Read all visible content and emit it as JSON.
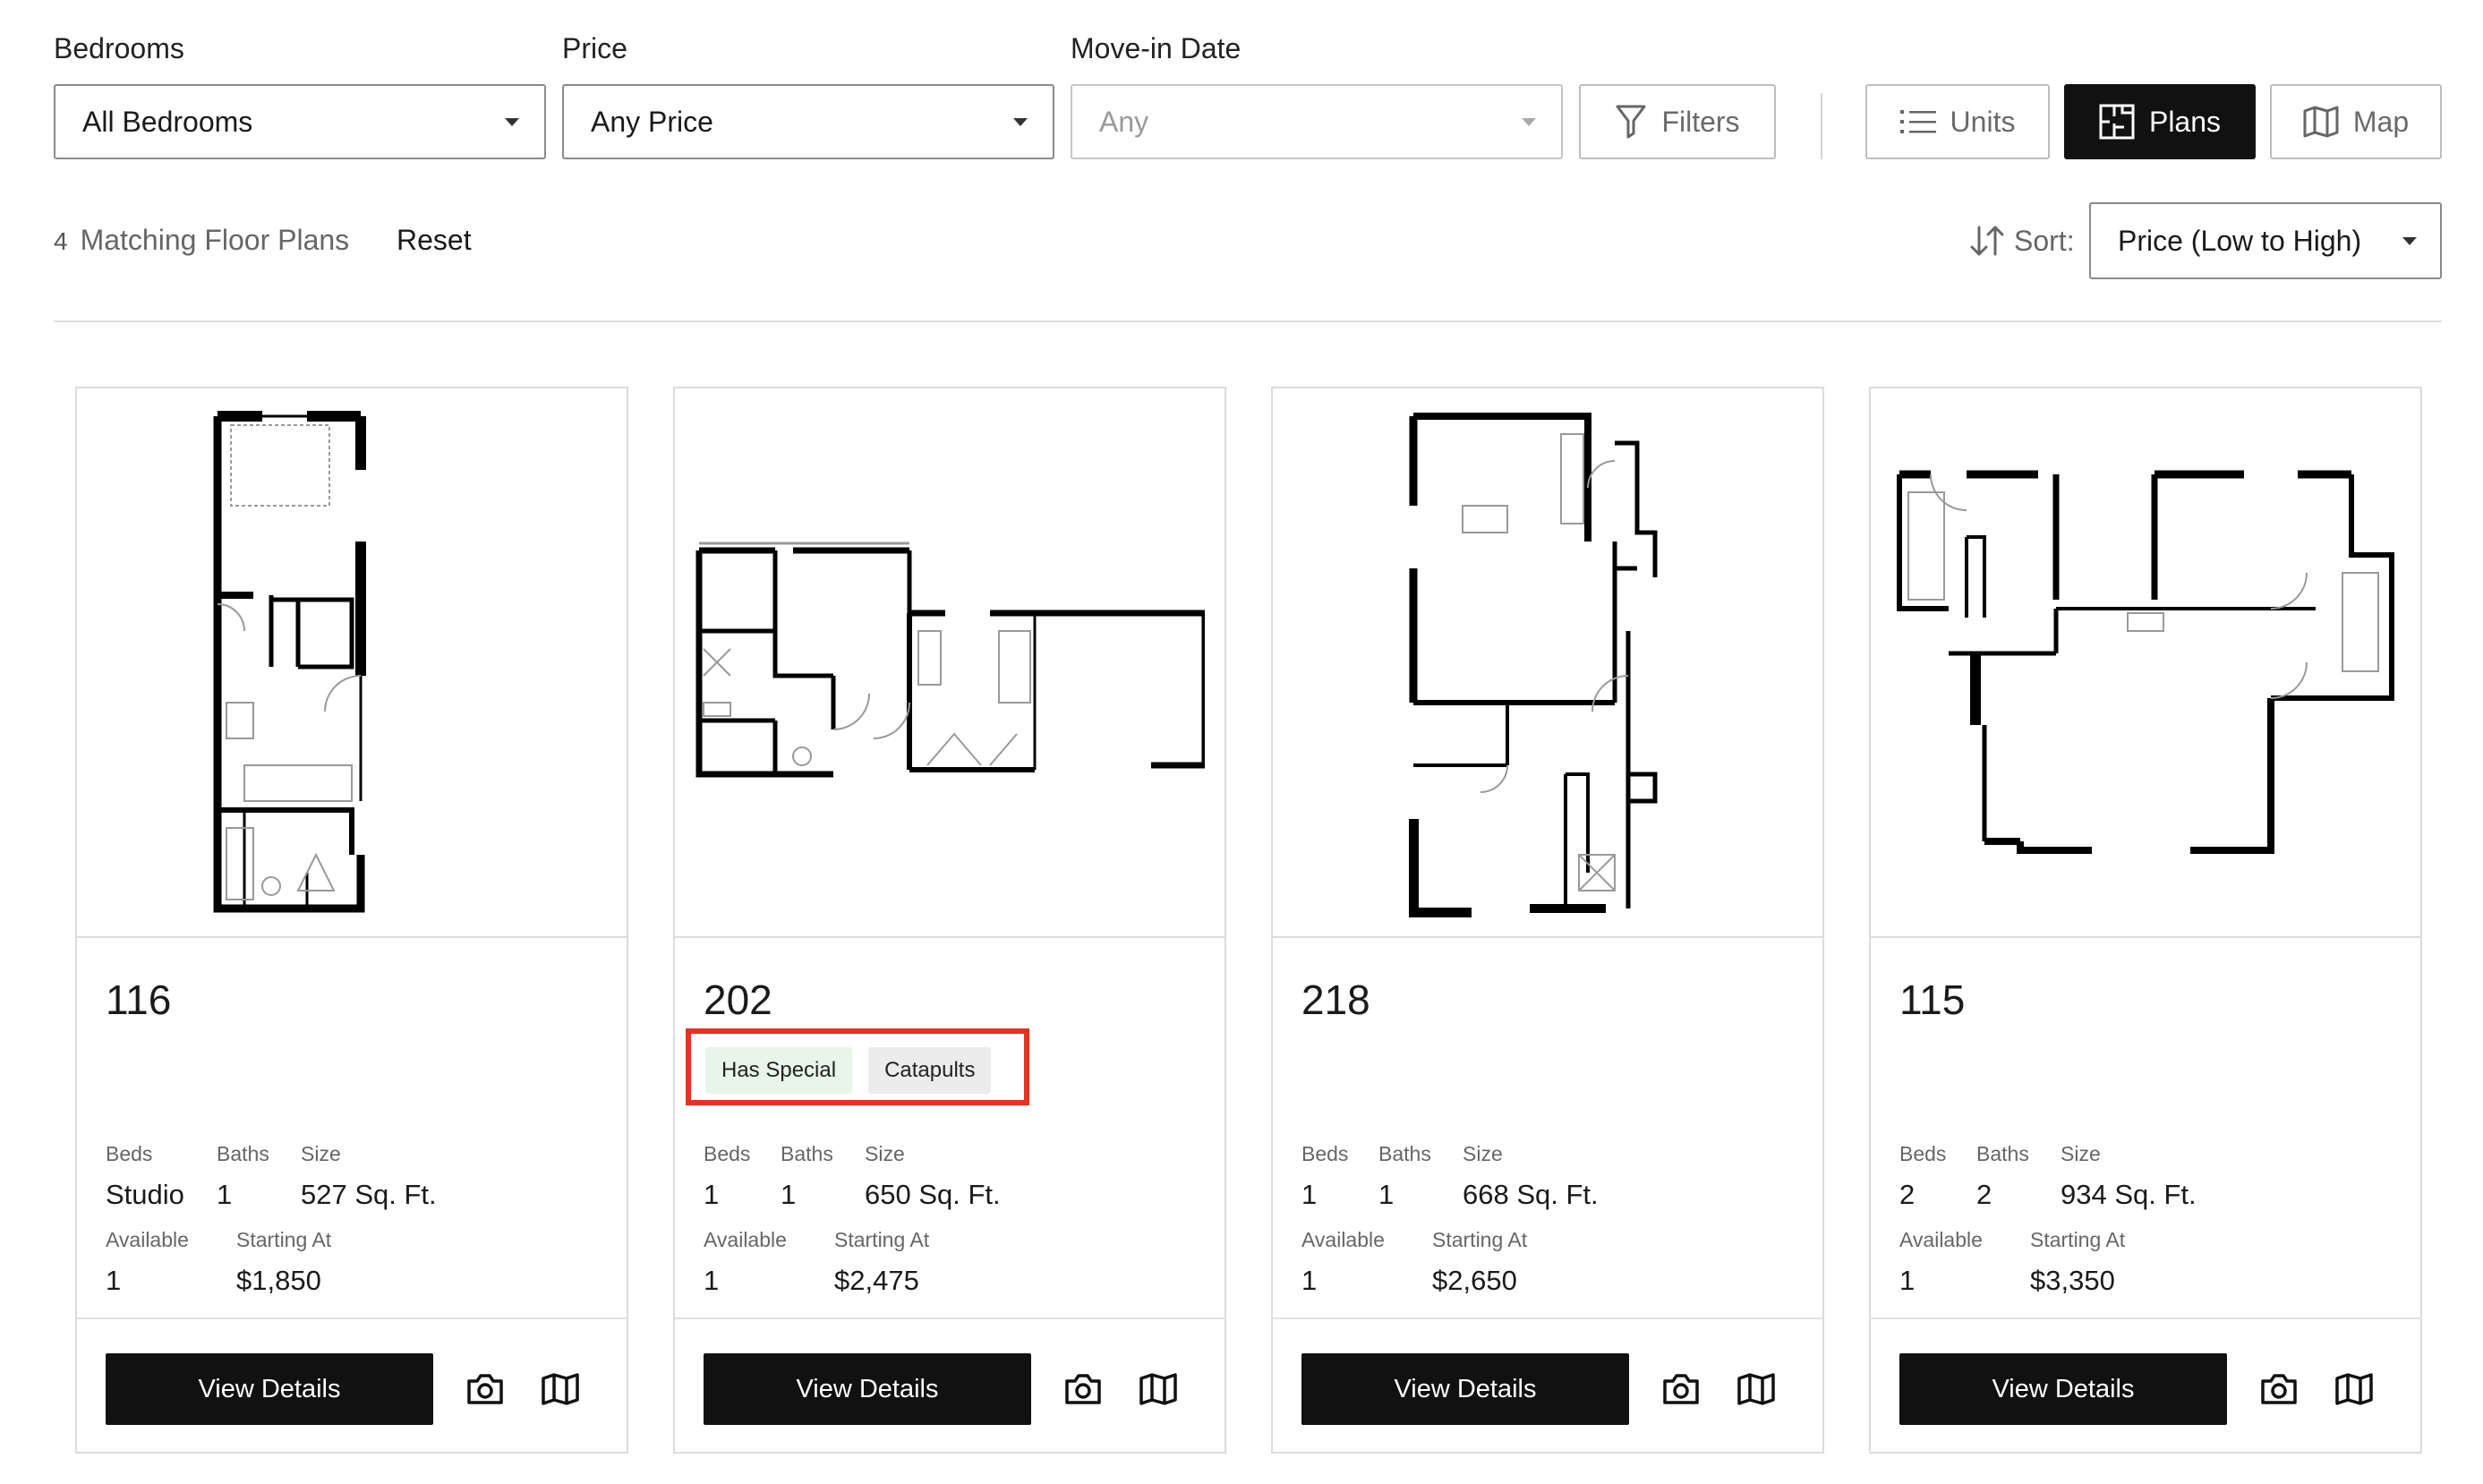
{
  "filters": {
    "bedrooms": {
      "label": "Bedrooms",
      "value": "All Bedrooms"
    },
    "price": {
      "label": "Price",
      "value": "Any Price"
    },
    "move_in": {
      "label": "Move-in Date",
      "value": "Any"
    },
    "filters_button": "Filters"
  },
  "views": {
    "units": "Units",
    "plans": "Plans",
    "map": "Map",
    "active": "Plans"
  },
  "results": {
    "count": "4",
    "label": "Matching Floor Plans",
    "reset": "Reset",
    "sort_label": "Sort:",
    "sort_value": "Price (Low to High)"
  },
  "labels": {
    "beds": "Beds",
    "baths": "Baths",
    "size": "Size",
    "available": "Available",
    "starting_at": "Starting At",
    "view_details": "View Details"
  },
  "cards": [
    {
      "unit": "116",
      "tags": [],
      "beds": "Studio",
      "baths": "1",
      "size": "527 Sq. Ft.",
      "available": "1",
      "price": "$1,850"
    },
    {
      "unit": "202",
      "tags": [
        "Has Special",
        "Catapults"
      ],
      "beds": "1",
      "baths": "1",
      "size": "650 Sq. Ft.",
      "available": "1",
      "price": "$2,475"
    },
    {
      "unit": "218",
      "tags": [],
      "beds": "1",
      "baths": "1",
      "size": "668 Sq. Ft.",
      "available": "1",
      "price": "$2,650"
    },
    {
      "unit": "115",
      "tags": [],
      "beds": "2",
      "baths": "2",
      "size": "934 Sq. Ft.",
      "available": "1",
      "price": "$3,350"
    }
  ],
  "icons": {
    "filters": "funnel-icon",
    "units": "list-icon",
    "plans": "floorplan-icon",
    "map": "map-icon",
    "sort": "sort-arrows-icon",
    "photos": "camera-icon",
    "tour": "map-icon"
  },
  "colors": {
    "primary": "#111111",
    "highlight": "#e53222",
    "special_tag_bg": "#e8f5e9",
    "tag_bg": "#ececec"
  }
}
